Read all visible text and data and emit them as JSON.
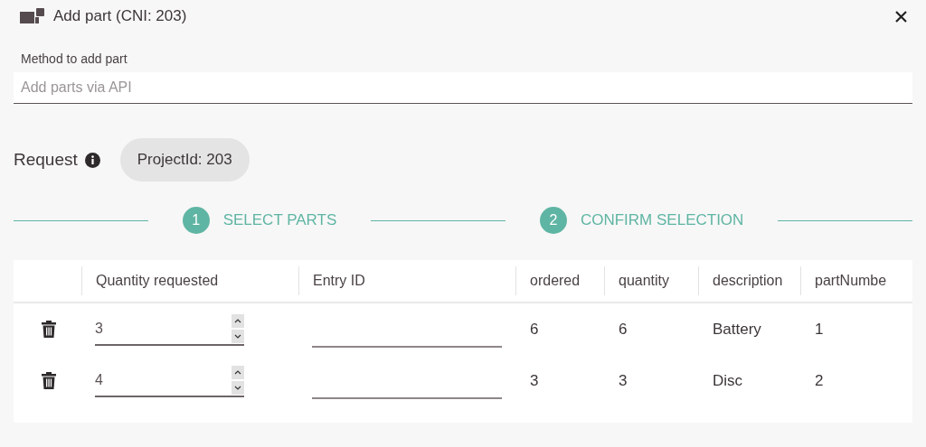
{
  "dialog": {
    "title": "Add part (CNI: 203)"
  },
  "method_field": {
    "label": "Method to add part",
    "placeholder": "Add parts via API"
  },
  "request": {
    "label": "Request",
    "chip": "ProjectId: 203"
  },
  "steps": [
    {
      "number": "1",
      "label": "SELECT PARTS"
    },
    {
      "number": "2",
      "label": "CONFIRM SELECTION"
    }
  ],
  "table": {
    "columns": [
      "Quantity requested",
      "Entry ID",
      "ordered",
      "quantity",
      "description",
      "partNumbe"
    ],
    "rows": [
      {
        "quantity_requested": "3",
        "ordered": "6",
        "quantity": "6",
        "description": "Battery",
        "part_number": "1"
      },
      {
        "quantity_requested": "4",
        "ordered": "3",
        "quantity": "3",
        "description": "Disc",
        "part_number": "2"
      }
    ]
  }
}
